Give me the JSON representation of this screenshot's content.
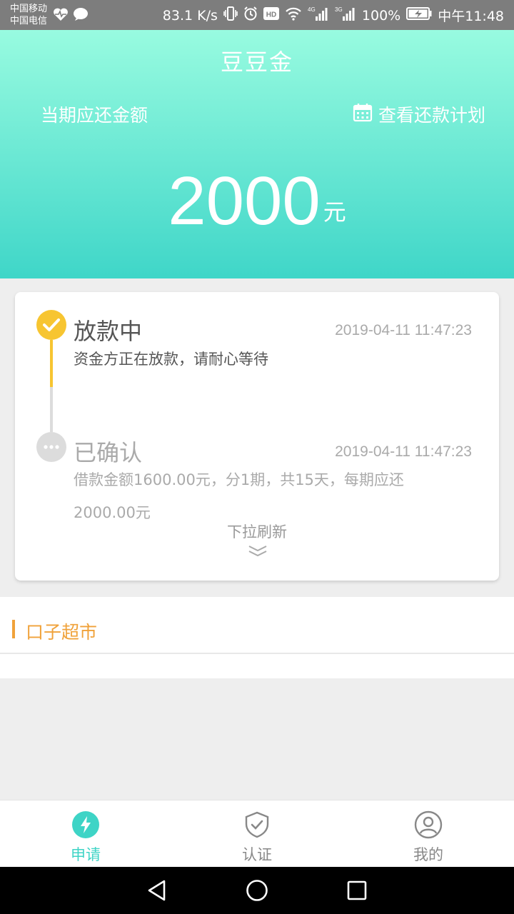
{
  "status_bar": {
    "carrier_1": "中国移动",
    "carrier_2": "中国电信",
    "speed": "83.1 K/s",
    "net_1": "4G",
    "net_2": "3G",
    "battery": "100%",
    "time": "中午11:48"
  },
  "header": {
    "title": "豆豆金",
    "due_label": "当期应还金额",
    "plan_link": "查看还款计划",
    "amount": "2000",
    "unit": "元",
    "gradient_top": "#98fbe0",
    "gradient_bottom": "#3fd6c8"
  },
  "progress": {
    "steps": [
      {
        "title": "放款中",
        "time": "2019-04-11 11:47:23",
        "desc": "资金方正在放款，请耐心等待",
        "state": "active",
        "icon": "check-icon",
        "color": "#f7c531"
      },
      {
        "title": "已确认",
        "time": "2019-04-11 11:47:23",
        "desc": "借款金额1600.00元，分1期，共15天，每期应还2000.00元",
        "state": "pending",
        "icon": "more-dots-icon",
        "color": "#dcdcdc"
      }
    ],
    "pull_refresh": "下拉刷新"
  },
  "market": {
    "title": "口子超市",
    "accent": "#f0a23a"
  },
  "bottom_nav": {
    "items": [
      {
        "label": "申请",
        "icon": "lightning-icon",
        "active": true
      },
      {
        "label": "认证",
        "icon": "shield-check-icon",
        "active": false
      },
      {
        "label": "我的",
        "icon": "user-icon",
        "active": false
      }
    ],
    "active_color": "#3ed4c6"
  }
}
